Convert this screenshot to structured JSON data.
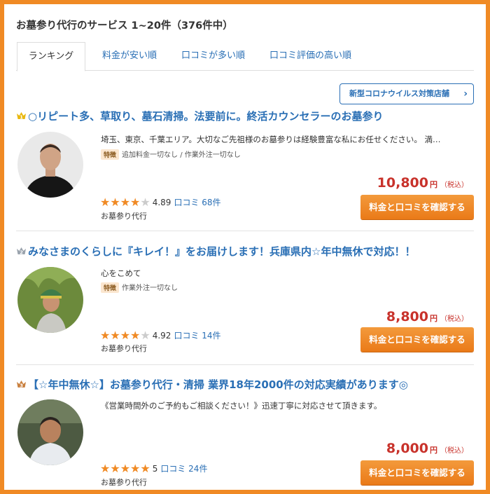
{
  "heading": "お墓参り代行のサービス 1~20件（376件中）",
  "tabs": [
    {
      "label": "ランキング",
      "active": true
    },
    {
      "label": "料金が安い順",
      "active": false
    },
    {
      "label": "口コミが多い順",
      "active": false
    },
    {
      "label": "口コミ評価の高い順",
      "active": false
    }
  ],
  "covid_button": {
    "label": "新型コロナウイルス対策店舗",
    "icon": "chevron-right-icon"
  },
  "feature_badge": "特徴",
  "listings": [
    {
      "rank": 1,
      "rank_icon": "gold-crown-icon",
      "title": "○リピート多、草取り、墓石清掃。法要前に。終活カウンセラーのお墓参り",
      "description": "埼玉、東京、千葉エリア。大切なご先祖様のお墓参りは経験豊富な私にお任せください。 満…",
      "features": "追加料金一切なし / 作業外注一切なし",
      "rating_stars": 4,
      "score": "4.89",
      "review_label": "口コミ 68件",
      "category": "お墓参り代行",
      "price": "10,800",
      "yen": "円",
      "tax": "（税込）",
      "cta": "料金と口コミを確認する"
    },
    {
      "rank": 2,
      "rank_icon": "silver-crown-icon",
      "title": "みなさまのくらしに『キレイ！』をお届けします！兵庫県内☆年中無休で対応！！",
      "description": "心をこめて",
      "features": "作業外注一切なし",
      "rating_stars": 4,
      "score": "4.92",
      "review_label": "口コミ 14件",
      "category": "お墓参り代行",
      "price": "8,800",
      "yen": "円",
      "tax": "（税込）",
      "cta": "料金と口コミを確認する"
    },
    {
      "rank": 3,
      "rank_icon": "bronze-crown-icon",
      "title": "【☆年中無休☆】お墓参り代行・清掃 業界18年2000件の対応実績があります◎",
      "description": "《営業時間外のご予約もご相談ください！》迅速丁寧に対応させて頂きます。",
      "features": "",
      "rating_stars": 5,
      "score": "5",
      "review_label": "口コミ 24件",
      "category": "お墓参り代行",
      "price": "8,000",
      "yen": "円",
      "tax": "（税込）",
      "cta": "料金と口コミを確認する"
    }
  ],
  "colors": {
    "accent_orange": "#f08a24",
    "link_blue": "#2a6fb5",
    "price_red": "#c8322b"
  }
}
